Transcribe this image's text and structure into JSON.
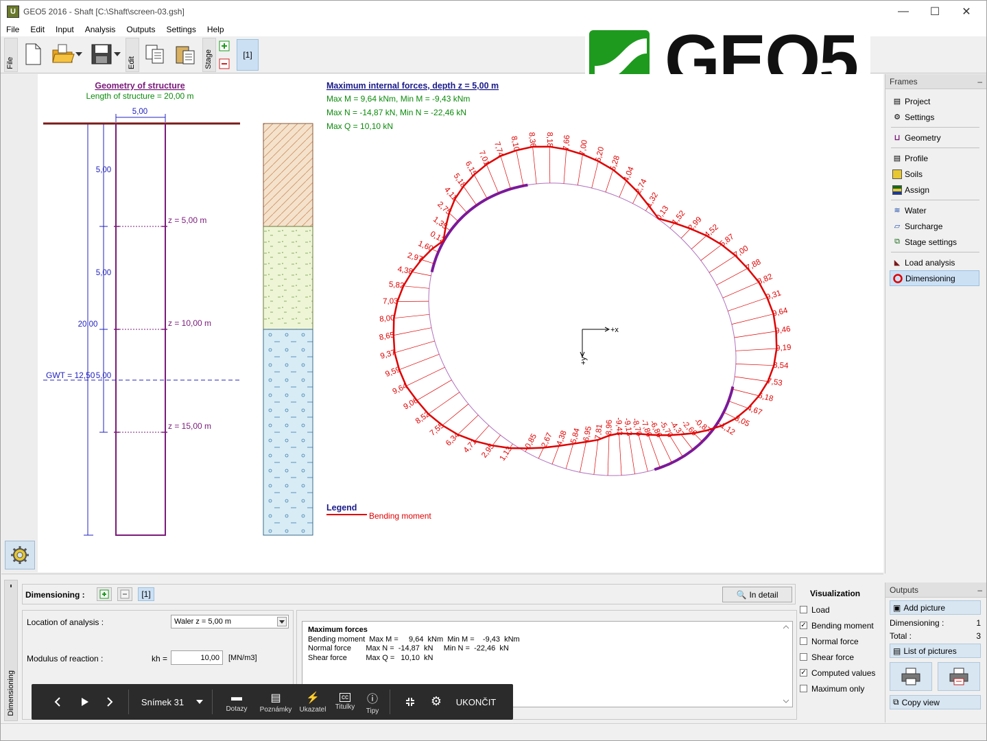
{
  "window": {
    "title": "GEO5 2016 - Shaft [C:\\Shaft\\screen-03.gsh]",
    "app_icon": "U",
    "minimize": "—",
    "maximize": "☐",
    "close": "✕"
  },
  "menu": [
    "File",
    "Edit",
    "Input",
    "Analysis",
    "Outputs",
    "Settings",
    "Help"
  ],
  "toolbar": {
    "group_file": "File",
    "group_edit": "Edit",
    "group_stage": "Stage",
    "stage_label": "[1]"
  },
  "logo": {
    "text": "GEO5"
  },
  "drawing": {
    "geometry_title": "Geometry of structure",
    "length_label": "Length of structure = 20,00 m",
    "width_dim": "5,00",
    "dims": [
      "5,00",
      "5,00",
      "20,00",
      "5,00"
    ],
    "depths": [
      "z = 5,00 m",
      "z = 10,00 m",
      "z = 15,00 m"
    ],
    "gwt": "GWT = 12,50",
    "forces_title": "Maximum internal forces, depth z = 5,00 m",
    "max_m": "Max M = 9,64 kNm, Min M = -9,43 kNm",
    "max_n": "Max N = -14,87 kN, Min N = -22,46 kN",
    "max_q": "Max Q = 10,10 kN",
    "axis_x": "+x",
    "axis_y": "+y",
    "legend_title": "Legend",
    "legend_item": "Bending moment",
    "moment_labels": [
      "0,13",
      "1,52",
      "2,99",
      "4,52",
      "5,87",
      "7,00",
      "7,88",
      "8,82",
      "9,31",
      "9,64",
      "9,46",
      "9,19",
      "8,54",
      "7,53",
      "6,18",
      "4,67",
      "3,05",
      "1,12",
      "-0,87",
      "-2,66",
      "-4,37",
      "-5,70",
      "-6,86",
      "-7,86",
      "-8,70",
      "-9,13",
      "-9,43",
      "-8,96",
      "-7,81",
      "-6,95",
      "-5,84",
      "-4,38",
      "-2,67",
      "-0,85",
      "1,13",
      "2,95",
      "4,71",
      "6,34",
      "7,55",
      "8,52",
      "9,06",
      "9,64",
      "9,59",
      "9,37",
      "8,65",
      "8,00",
      "7,03",
      "5,82",
      "4,38",
      "2,97",
      "1,60",
      "0,12",
      "1,35",
      "2,75",
      "4,11",
      "5,18",
      "6,15",
      "7,01",
      "7,74",
      "8,10",
      "8,36",
      "8,18",
      "7,66",
      "7,00",
      "6,20",
      "5,28",
      "4,04",
      "2,74",
      "1,32"
    ]
  },
  "frames": {
    "header": "Frames",
    "collapse": "‒",
    "items": [
      "Project",
      "Settings",
      "Geometry",
      "Profile",
      "Soils",
      "Assign",
      "Water",
      "Surcharge",
      "Stage settings",
      "Load analysis",
      "Dimensioning"
    ]
  },
  "bottom": {
    "tab_label": "Dimensioning",
    "header_label": "Dimensioning :",
    "stage_btn": "[1]",
    "in_detail": "In detail",
    "location_label": "Location of analysis :",
    "location_value": "Waler z = 5,00 m",
    "modulus_label": "Modulus of reaction :",
    "kh_label": "kh =",
    "kh_value": "10,00",
    "kh_unit": "[MN/m3]",
    "results_title": "Maximum forces",
    "results_rows": [
      "Bending moment  Max M =     9,64  kNm  Min M =    -9,43  kNm",
      "Normal force       Max N =  -14,87  kN     Min N =  -22,46  kN",
      "Shear force         Max Q =   10,10  kN"
    ]
  },
  "visualization": {
    "header": "Visualization",
    "items": [
      {
        "label": "Load",
        "checked": false
      },
      {
        "label": "Bending moment",
        "checked": true
      },
      {
        "label": "Normal force",
        "checked": false
      },
      {
        "label": "Shear force",
        "checked": false
      },
      {
        "label": "Computed values",
        "checked": true
      },
      {
        "label": "Maximum only",
        "checked": false
      }
    ]
  },
  "outputs": {
    "header": "Outputs",
    "add_picture": "Add picture",
    "dim_label": "Dimensioning :",
    "dim_value": "1",
    "total_label": "Total :",
    "total_value": "3",
    "list_pictures": "List of pictures",
    "copy_view": "Copy view"
  },
  "player": {
    "slide": "Snímek 31",
    "dotazy": "Dotazy",
    "poznamky": "Poznámky",
    "ukazatel": "Ukazatel",
    "titulky": "Titulky",
    "tipy": "Tipy",
    "end": "UKONČIT"
  },
  "colors": {
    "structure": "#7a1a7a",
    "dimension": "#2020c0",
    "moment": "#e00000",
    "title": "#1a1a8a",
    "info": "#0a8a0a"
  }
}
